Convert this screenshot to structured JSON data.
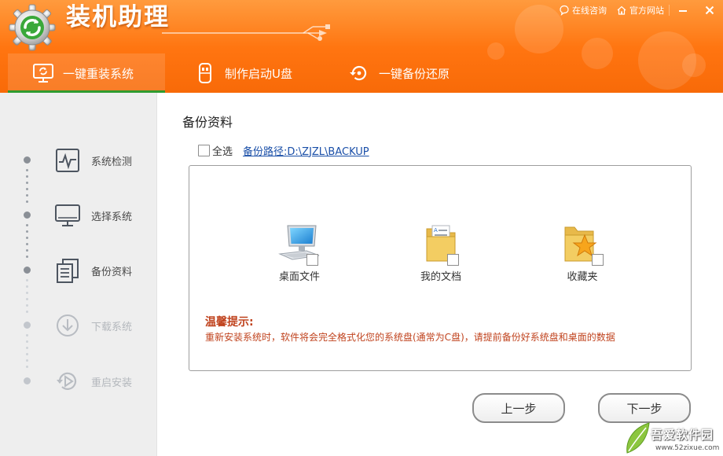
{
  "app": {
    "title": "装机助理"
  },
  "top_links": {
    "consult": "在线咨询",
    "website": "官方网站"
  },
  "tabs": [
    {
      "label": "一键重装系统",
      "active": true
    },
    {
      "label": "制作启动U盘",
      "active": false
    },
    {
      "label": "一键备份还原",
      "active": false
    }
  ],
  "steps": [
    {
      "label": "系统检测",
      "state": "done",
      "icon": "monitor-pulse-icon"
    },
    {
      "label": "选择系统",
      "state": "done",
      "icon": "desktop-icon"
    },
    {
      "label": "备份资料",
      "state": "current",
      "icon": "documents-icon"
    },
    {
      "label": "下载系统",
      "state": "todo",
      "icon": "download-icon"
    },
    {
      "label": "重启安装",
      "state": "todo",
      "icon": "restart-icon"
    }
  ],
  "main": {
    "title": "备份资料",
    "select_all": "全选",
    "backup_path": "备份路径:D:\\ZJZL\\BACKUP",
    "items": [
      {
        "label": "桌面文件",
        "icon": "computer-icon",
        "checked": false
      },
      {
        "label": "我的文档",
        "icon": "documents-folder-icon",
        "checked": false
      },
      {
        "label": "收藏夹",
        "icon": "favorites-folder-icon",
        "checked": false
      }
    ],
    "tip_title": "温馨提示:",
    "tip_text": "重新安装系统时，软件将会完全格式化您的系统盘(通常为C盘)，请提前备份好系统盘和桌面的数据"
  },
  "buttons": {
    "prev": "上一步",
    "next": "下一步"
  },
  "watermark": {
    "text": "吾爱软件园",
    "sub": "www.52zixue.com"
  },
  "colors": {
    "header": "#ff7a14",
    "tab_indicator": "#2f9b2f",
    "tip": "#c0431e",
    "link": "#1a4fa8",
    "sidebar": "#eeeeee"
  }
}
